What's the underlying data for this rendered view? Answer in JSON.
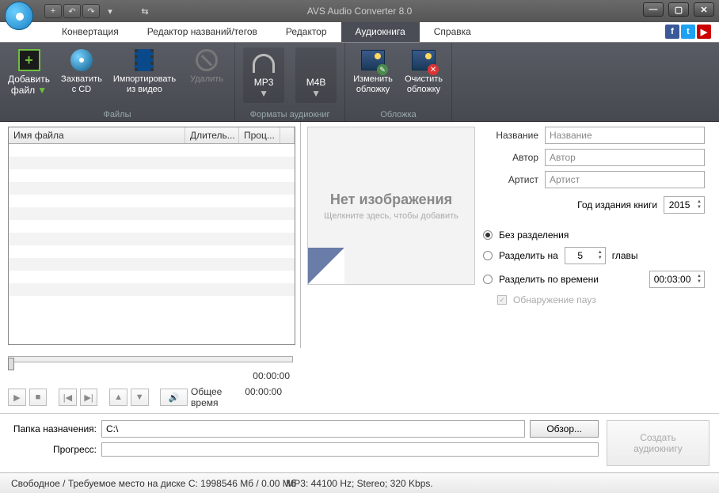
{
  "title": "AVS Audio Converter 8.0",
  "tabs": {
    "items": [
      "Конвертация",
      "Редактор названий/тегов",
      "Редактор",
      "Аудиокнига",
      "Справка"
    ],
    "active_index": 3
  },
  "ribbon": {
    "add_file": "Добавить\nфайл",
    "grab_cd": "Захватить\nс CD",
    "import_video": "Импортировать\nиз видео",
    "delete": "Удалить",
    "files_group": "Файлы",
    "mp3": "MP3",
    "m4b": "M4B",
    "formats_group": "Форматы аудиокниг",
    "change_cover": "Изменить\nобложку",
    "clear_cover": "Очистить\nобложку",
    "cover_group": "Обложка"
  },
  "file_table": {
    "col_name": "Имя файла",
    "col_duration": "Длитель...",
    "col_progress": "Проц..."
  },
  "cover": {
    "title": "Нет изображения",
    "subtitle": "Щелкните здесь, чтобы добавить"
  },
  "meta": {
    "title_label": "Название",
    "title_value": "Название",
    "author_label": "Автор",
    "author_value": "Автор",
    "artist_label": "Артист",
    "artist_value": "Артист",
    "year_label": "Год издания книги",
    "year_value": "2015"
  },
  "split": {
    "none": "Без разделения",
    "by_count": "Разделить на",
    "by_count_value": "5",
    "by_count_unit": "главы",
    "by_time": "Разделить по времени",
    "by_time_value": "00:03:00",
    "pause_detect": "Обнаружение пауз",
    "selected": "none"
  },
  "timeline": {
    "position": "00:00:00",
    "total_label": "Общее время",
    "total_value": "00:00:00"
  },
  "bottom": {
    "dest_label": "Папка назначения:",
    "dest_value": "C:\\",
    "browse": "Обзор...",
    "progress_label": "Прогресс:",
    "create": "Создать аудиокнигу"
  },
  "status": {
    "space": "Свободное / Требуемое место на диске C: 1998546 Мб / 0.00 Мб",
    "format": "MP3: 44100  Hz; Stereo; 320 Kbps."
  }
}
